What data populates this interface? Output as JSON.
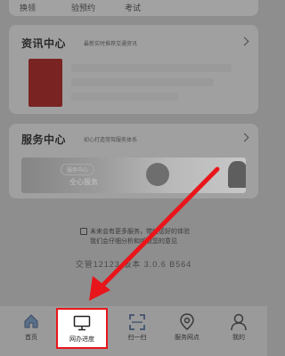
{
  "top_tabs": [
    "换领",
    "验预约",
    "考试"
  ],
  "info": {
    "title": "资讯中心",
    "subtitle": "最新实时推荐交通资讯"
  },
  "service": {
    "title": "服务中心",
    "subtitle": "初心打造常驾服务体系",
    "banner_pill": "服务中心",
    "banner_text": "全心服务"
  },
  "notice": {
    "line1": "未来会有更多服务，带给您好的体验",
    "line2": "我们会仔细分析和听取您的意见"
  },
  "version": "交管12123 版本 3.0.6 B564",
  "nav": [
    {
      "label": "首页",
      "icon": "home-icon"
    },
    {
      "label": "网办进度",
      "icon": "monitor-icon"
    },
    {
      "label": "扫一扫",
      "icon": "scan-icon"
    },
    {
      "label": "服务网点",
      "icon": "location-icon"
    },
    {
      "label": "我的",
      "icon": "person-icon"
    }
  ],
  "highlight_color": "#e8161b"
}
